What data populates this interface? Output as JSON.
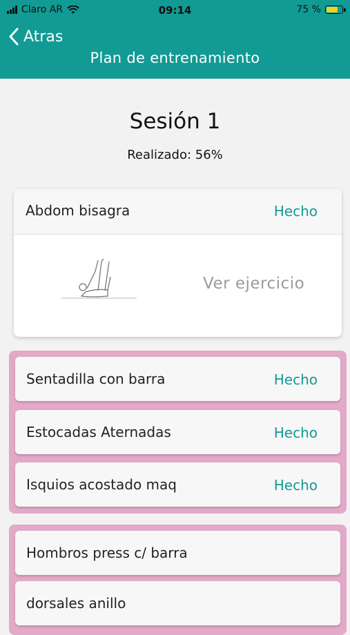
{
  "status_bar": {
    "carrier": "Claro AR",
    "time": "09:14",
    "battery": "75 %",
    "battery_level": 0.75
  },
  "nav": {
    "back_label": "Atras",
    "title": "Plan de entrenamiento"
  },
  "session": {
    "title": "Sesión 1",
    "progress": "Realizado: 56%"
  },
  "first_exercise": {
    "label": "Abdom bisagra",
    "status": "Hecho",
    "view_label": "Ver ejercicio"
  },
  "group1": {
    "items": [
      {
        "label": "Sentadilla con barra",
        "status": "Hecho"
      },
      {
        "label": "Estocadas Aternadas",
        "status": "Hecho"
      },
      {
        "label": "Isquios acostado maq",
        "status": "Hecho"
      }
    ]
  },
  "group2": {
    "items": [
      {
        "label": "Hombros press c/ barra"
      },
      {
        "label": "dorsales anillo"
      }
    ]
  },
  "colors": {
    "accent": "#129a94",
    "group_border": "#e3a9c9",
    "battery": "#f2d21c"
  }
}
